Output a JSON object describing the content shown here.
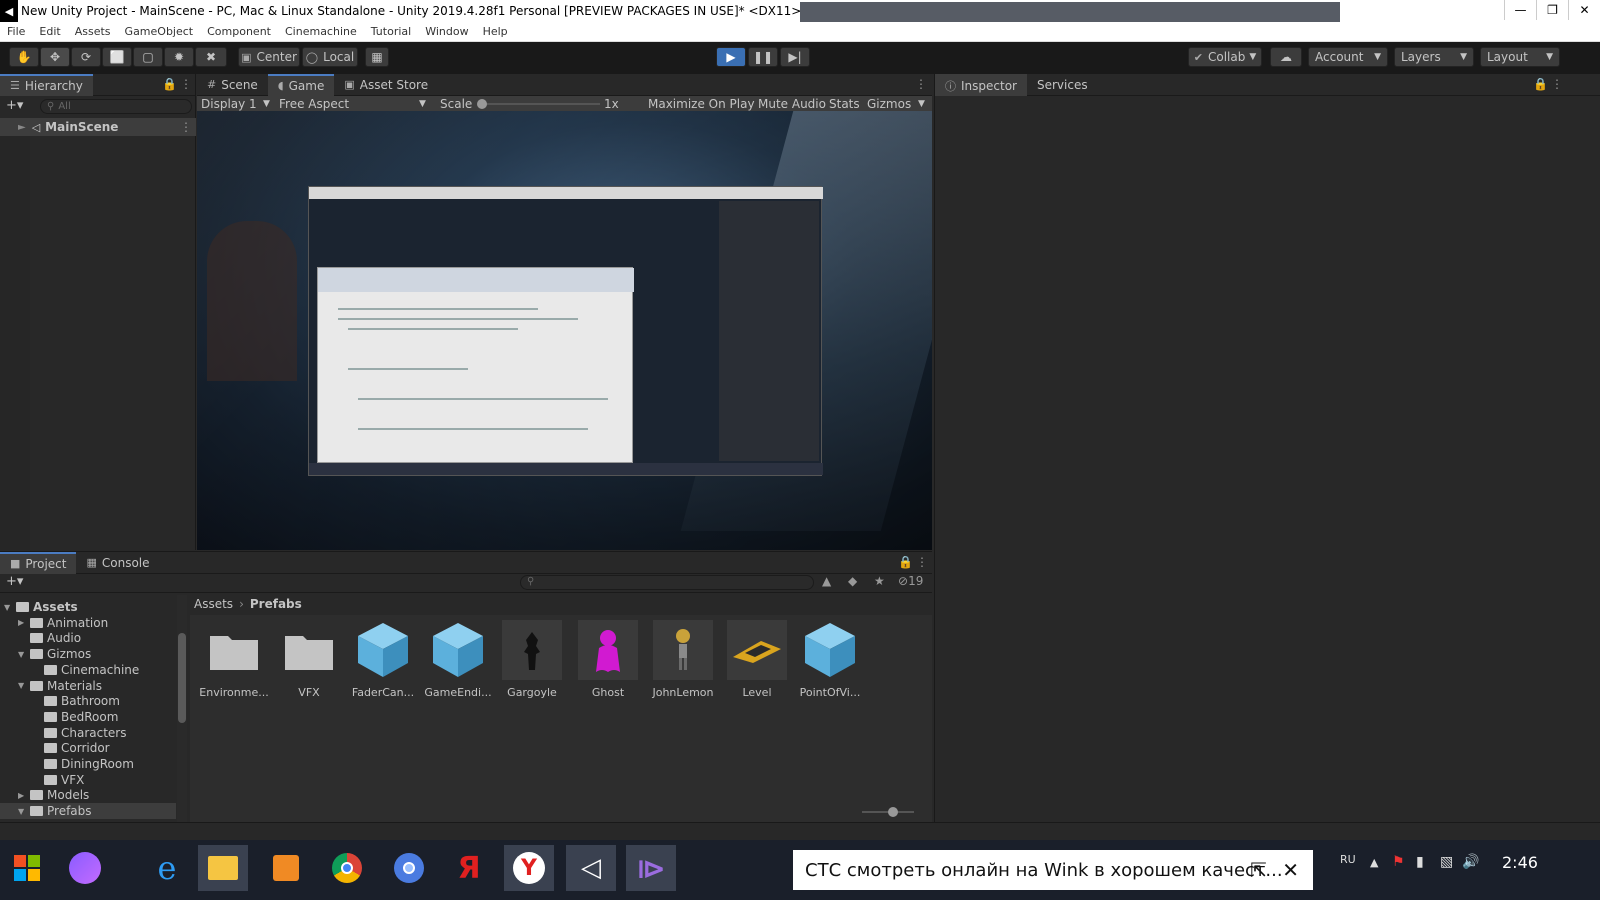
{
  "window": {
    "title": "New Unity Project - MainScene - PC, Mac & Linux Standalone - Unity 2019.4.28f1 Personal [PREVIEW PACKAGES IN USE]* <DX11>",
    "logo": "◀"
  },
  "menu": [
    "File",
    "Edit",
    "Assets",
    "GameObject",
    "Component",
    "Cinemachine",
    "Tutorial",
    "Window",
    "Help"
  ],
  "toolbar": {
    "center_label": "Center",
    "local_label": "Local",
    "collab_label": "Collab",
    "account_label": "Account",
    "layers_label": "Layers",
    "layout_label": "Layout"
  },
  "hierarchy": {
    "tab_label": "Hierarchy",
    "search_placeholder": "All",
    "scene_name": "MainScene"
  },
  "center_tabs": {
    "scene": "Scene",
    "game": "Game",
    "asset_store": "Asset Store"
  },
  "game_toolbar": {
    "display": "Display 1",
    "aspect": "Free Aspect",
    "scale_label": "Scale",
    "scale_value": "1x",
    "maximize": "Maximize On Play",
    "mute": "Mute Audio",
    "stats": "Stats",
    "gizmos": "Gizmos"
  },
  "right_tabs": {
    "inspector": "Inspector",
    "services": "Services"
  },
  "project": {
    "tab_project": "Project",
    "tab_console": "Console",
    "hidden_count": "19",
    "breadcrumb_root": "Assets",
    "breadcrumb_current": "Prefabs",
    "tree": [
      {
        "label": "Assets",
        "depth": 0,
        "open": true,
        "bold": true
      },
      {
        "label": "Animation",
        "depth": 1,
        "arrow": "right"
      },
      {
        "label": "Audio",
        "depth": 1
      },
      {
        "label": "Gizmos",
        "depth": 1,
        "arrow": "down"
      },
      {
        "label": "Cinemachine",
        "depth": 2
      },
      {
        "label": "Materials",
        "depth": 1,
        "arrow": "down"
      },
      {
        "label": "Bathroom",
        "depth": 2
      },
      {
        "label": "BedRoom",
        "depth": 2
      },
      {
        "label": "Characters",
        "depth": 2
      },
      {
        "label": "Corridor",
        "depth": 2
      },
      {
        "label": "DiningRoom",
        "depth": 2
      },
      {
        "label": "VFX",
        "depth": 2
      },
      {
        "label": "Models",
        "depth": 1,
        "arrow": "right"
      },
      {
        "label": "Prefabs",
        "depth": 1,
        "arrow": "down",
        "selected": true
      }
    ],
    "assets": [
      {
        "label": "Environme...",
        "kind": "folder"
      },
      {
        "label": "VFX",
        "kind": "folder"
      },
      {
        "label": "FaderCan...",
        "kind": "cube"
      },
      {
        "label": "GameEndi...",
        "kind": "cube"
      },
      {
        "label": "Gargoyle",
        "kind": "gargoyle"
      },
      {
        "label": "Ghost",
        "kind": "ghost"
      },
      {
        "label": "JohnLemon",
        "kind": "john"
      },
      {
        "label": "Level",
        "kind": "level"
      },
      {
        "label": "PointOfVi...",
        "kind": "cube"
      }
    ]
  },
  "taskbar": {
    "notification": "СТС смотреть онлайн на Wink в хорошем качест...",
    "lang": "RU",
    "time": "2:46"
  },
  "colors": {
    "play_active": "#3a6fb3",
    "tab_highlight": "#4b7cc2",
    "cube_blue": "#5cb0dc",
    "ghost_magenta": "#d11ad1"
  }
}
